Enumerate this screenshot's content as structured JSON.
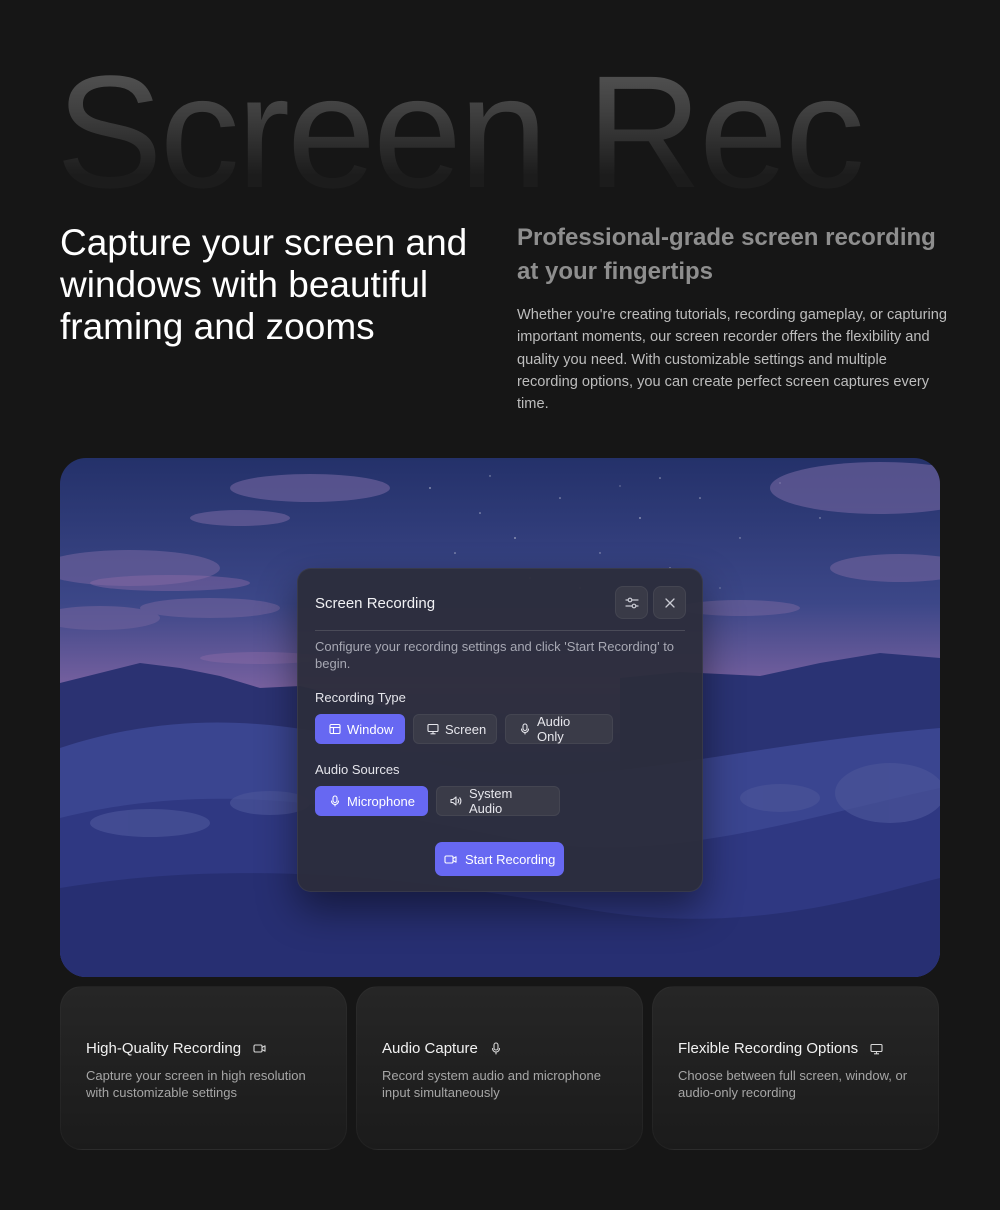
{
  "hero": {
    "word": "Screen Rec",
    "headline": "Capture your screen and windows with beautiful framing and zooms",
    "subheadline": "Professional-grade screen recording at your fingertips",
    "paragraph": "Whether you're creating tutorials, recording gameplay, or capturing important moments, our screen recorder offers the flexibility and quality you need. With customizable settings and multiple recording options, you can create perfect screen captures every time."
  },
  "panel": {
    "title": "Screen Recording",
    "settings_icon": "sliders-icon",
    "close_icon": "close-icon",
    "description": "Configure your recording settings and click 'Start Recording' to begin.",
    "recording_type": {
      "label": "Recording Type",
      "options": [
        {
          "label": "Window",
          "icon": "window-icon",
          "selected": true
        },
        {
          "label": "Screen",
          "icon": "monitor-icon",
          "selected": false
        },
        {
          "label": "Audio Only",
          "icon": "microphone-icon",
          "selected": false
        }
      ]
    },
    "audio_sources": {
      "label": "Audio Sources",
      "options": [
        {
          "label": "Microphone",
          "icon": "microphone-icon",
          "selected": true
        },
        {
          "label": "System Audio",
          "icon": "speaker-icon",
          "selected": false
        }
      ]
    },
    "start_button": {
      "label": "Start Recording",
      "icon": "video-camera-icon"
    }
  },
  "features": [
    {
      "title": "High-Quality Recording",
      "icon": "video-camera-icon",
      "description": "Capture your screen in high resolution with customizable settings"
    },
    {
      "title": "Audio Capture",
      "icon": "microphone-icon",
      "description": "Record system audio and microphone input simultaneously"
    },
    {
      "title": "Flexible Recording Options",
      "icon": "monitor-icon",
      "description": "Choose between full screen, window, or audio-only recording"
    }
  ],
  "colors": {
    "accent": "#6768f2",
    "background": "#161616",
    "panel": "#2c2d3a"
  }
}
